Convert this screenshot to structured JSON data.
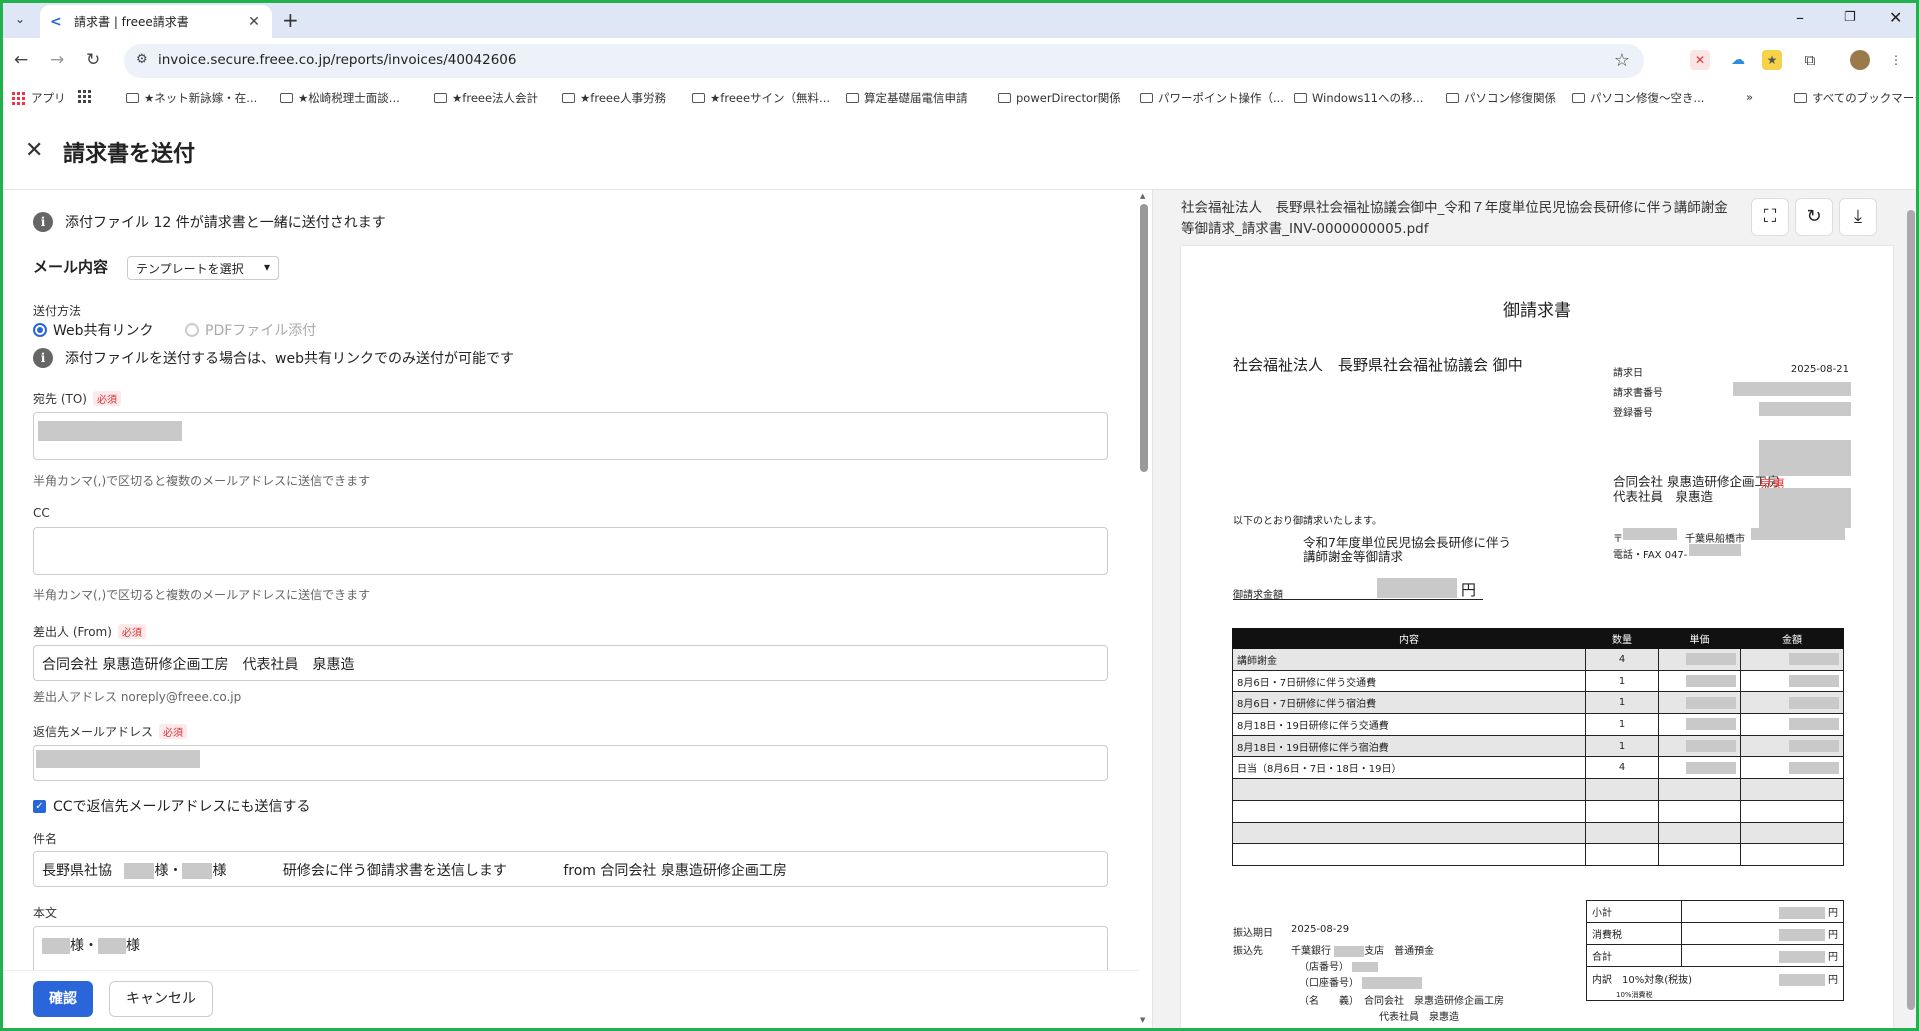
{
  "browser": {
    "tab_title": "請求書 | freee請求書",
    "url": "invoice.secure.freee.co.jp/reports/invoices/40042606",
    "bookmarks": [
      "アプリ",
      "★ネット新詠嫁・在...",
      "★松崎税理士面談...",
      "★freee法人会計",
      "★freee人事労務",
      "★freeeサイン（無料...",
      "算定基礎届電信申請",
      "powerDirector関係",
      "パワーポイント操作（...",
      "Windows11への移...",
      "パソコン修復関係",
      "パソコン修復〜空き...",
      "すべてのブックマーク"
    ]
  },
  "page": {
    "title": "請求書を送付",
    "attachments_notice": "添付ファイル 12 件が請求書と一緒に送付されます",
    "mail_section": "メール内容",
    "template_select": "テンプレートを選択",
    "send_method_label": "送付方法",
    "method_web": "Web共有リンク",
    "method_pdf": "PDFファイル添付",
    "web_only_notice": "添付ファイルを送付する場合は、web共有リンクでのみ送付が可能です",
    "to_label": "宛先 (TO)",
    "required": "必須",
    "comma_hint": "半角カンマ(,)で区切ると複数のメールアドレスに送信できます",
    "cc_label": "CC",
    "from_label": "差出人 (From)",
    "from_value": "合同会社 泉惠造研修企画工房　代表社員　泉惠造",
    "from_address_hint": "差出人アドレス noreply@freee.co.jp",
    "reply_label": "返信先メールアドレス",
    "cc_reply_check": "CCで返信先メールアドレスにも送信する",
    "subject_label": "件名",
    "subject_part1": "長野県社協",
    "subject_part2": "様・",
    "subject_part3": "様",
    "subject_part4": "研修会に伴う御請求書を送信します",
    "subject_part5": "from 合同会社 泉惠造研修企画工房",
    "body_label": "本文",
    "body_part1": "様・",
    "body_part2": "様",
    "confirm": "確認",
    "cancel": "キャンセル"
  },
  "preview": {
    "file_name": "社会福祉法人　長野県社会福祉協議会御中_令和７年度単位民児協会長研修に伴う講師謝金等御請求_請求書_INV-0000000005.pdf",
    "doc_title": "御請求書",
    "recipient": "社会福祉法人　長野県社会福祉協議会 御中",
    "invoice_date_label": "請求日",
    "invoice_date": "2025-08-21",
    "invoice_no_label": "請求書番号",
    "reg_no_label": "登録番号",
    "issuer_line1": "合同会社 泉惠造研修企画工房",
    "issuer_line2": "代表社員　泉惠造",
    "issuer_stamp": "泉惠",
    "postal_prefix": "〒",
    "address": "千葉県船橋市",
    "tel_fax": "電話・FAX 047-",
    "intro": "以下のとおり御請求いたします。",
    "subject_line1": "令和7年度単位民児協会長研修に伴う",
    "subject_line2": "講師謝金等御請求",
    "total_label": "御請求金額",
    "yen": "円",
    "table_headers": [
      "内容",
      "数量",
      "単価",
      "金額"
    ],
    "items": [
      {
        "name": "講師謝金",
        "qty": "4"
      },
      {
        "name": "8月6日・7日研修に伴う交通費",
        "qty": "1"
      },
      {
        "name": "8月6日・7日研修に伴う宿泊費",
        "qty": "1"
      },
      {
        "name": "8月18日・19日研修に伴う交通費",
        "qty": "1"
      },
      {
        "name": "8月18日・19日研修に伴う宿泊費",
        "qty": "1"
      },
      {
        "name": "日当（8月6日・7日・18日・19日）",
        "qty": "4"
      }
    ],
    "pay_date_label": "振込期日",
    "pay_date": "2025-08-29",
    "pay_to_label": "振込先",
    "bank": "千葉銀行",
    "branch": "支店　普通預金",
    "store_no": "（店番号）",
    "account_no": "（口座番号）",
    "holder_label": "（名　　義）",
    "holder_name": "合同会社　泉惠造研修企画工房",
    "holder_name2": "代表社員　泉惠造",
    "subtotal": "小計",
    "tax": "消費税",
    "total": "合計",
    "breakdown": "内訳",
    "rate": "10%対象(税抜)",
    "rate_tax": "10%消費税"
  },
  "colors": {
    "accent": "#2a65d9",
    "frame": "#22b14c"
  }
}
